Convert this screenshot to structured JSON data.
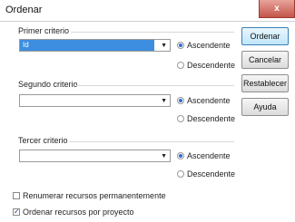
{
  "window": {
    "title": "Ordenar",
    "close_glyph": "x"
  },
  "groups": [
    {
      "label": "Primer criterio",
      "value": "Id",
      "radios": [
        {
          "label": "Ascendente",
          "checked": true
        },
        {
          "label": "Descendente",
          "checked": false
        }
      ]
    },
    {
      "label": "Segundo criterio",
      "value": "",
      "radios": [
        {
          "label": "Ascendente",
          "checked": true
        },
        {
          "label": "Descendente",
          "checked": false
        }
      ]
    },
    {
      "label": "Tercer criterio",
      "value": "",
      "radios": [
        {
          "label": "Ascendente",
          "checked": true
        },
        {
          "label": "Descendente",
          "checked": false
        }
      ]
    }
  ],
  "buttons": {
    "ordenar": "Ordenar",
    "cancelar": "Cancelar",
    "restablecer": "Restablecer",
    "ayuda": "Ayuda"
  },
  "checkboxes": [
    {
      "label": "Renumerar recursos permanentemente",
      "checked": false
    },
    {
      "label": "Ordenar recursos por proyecto",
      "checked": true
    }
  ],
  "combo_arrow": "▼",
  "check_glyph": "✓",
  "colors": {
    "selection": "#3d8ee0",
    "close_button": "#c4554a"
  }
}
